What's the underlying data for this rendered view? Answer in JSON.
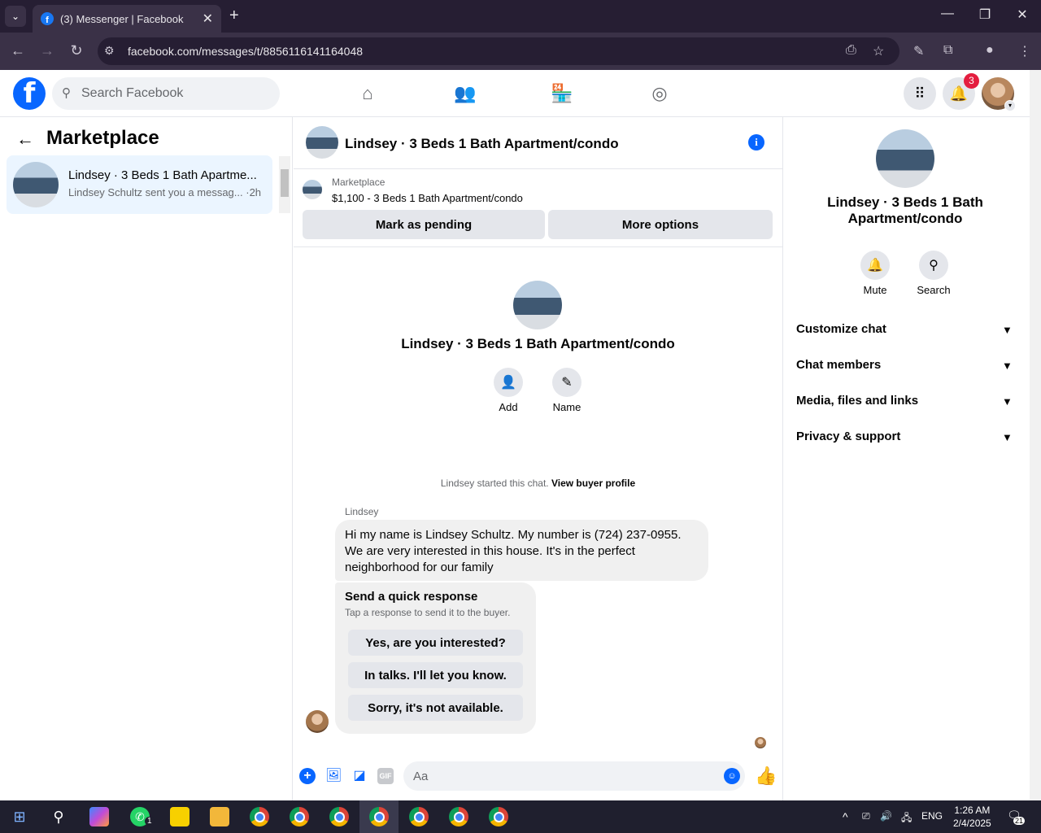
{
  "browser": {
    "tab_title": "(3) Messenger | Facebook",
    "url": "facebook.com/messages/t/8856116141164048"
  },
  "fb_header": {
    "search_placeholder": "Search Facebook",
    "notification_count": "3"
  },
  "left_panel": {
    "title": "Marketplace",
    "conversations": [
      {
        "title": "Lindsey · 3 Beds 1 Bath Apartme...",
        "snippet": "Lindsey Schultz sent you a messag...",
        "time": "·2h"
      }
    ]
  },
  "chat_header": {
    "title": "Lindsey · 3 Beds 1 Bath Apartment/condo"
  },
  "listing": {
    "label": "Marketplace",
    "price_title": "$1,100 - 3 Beds 1 Bath Apartment/condo",
    "mark_pending": "Mark as pending",
    "more_options": "More options"
  },
  "chat_intro": {
    "title": "Lindsey · 3 Beds 1 Bath Apartment/condo",
    "add_label": "Add",
    "name_label": "Name",
    "started_text": "Lindsey started this chat.",
    "buyer_profile_link": "View buyer profile"
  },
  "messages": [
    {
      "sender": "Lindsey",
      "text": "Hi my name is Lindsey Schultz. My number is (724) 237-0955. We are very interested in this house. It's in the perfect neighborhood for our family"
    }
  ],
  "quick_response": {
    "title": "Send a quick response",
    "subtitle": "Tap a response to send it to the buyer.",
    "options": [
      "Yes, are you interested?",
      "In talks. I'll let you know.",
      "Sorry, it's not available."
    ]
  },
  "composer": {
    "placeholder": "Aa",
    "gif_label": "GIF"
  },
  "right_panel": {
    "title": "Lindsey · 3 Beds 1 Bath Apartment/condo",
    "mute_label": "Mute",
    "search_label": "Search",
    "sections": [
      "Customize chat",
      "Chat members",
      "Media, files and links",
      "Privacy & support"
    ]
  },
  "taskbar": {
    "whatsapp_badge": "1",
    "lang": "ENG",
    "time": "1:26 AM",
    "date": "2/4/2025",
    "notif_count": "21"
  },
  "colors": {
    "fb_blue": "#0866ff",
    "selected_row": "#ebf5ff",
    "badge_red": "#e41e3f"
  }
}
